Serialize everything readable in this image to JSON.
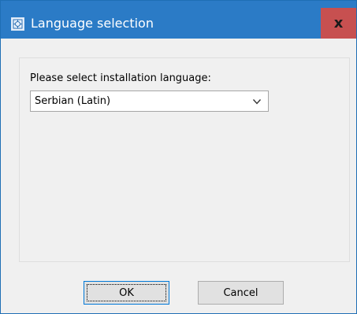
{
  "window": {
    "title": "Language selection",
    "close_label": "x"
  },
  "colors": {
    "titlebar": "#2b7bc6",
    "close_button": "#c75050",
    "dialog_background": "#f0f0f0",
    "focus_border": "#0078d7"
  },
  "icons": {
    "app": "installer-icon",
    "close": "close-icon",
    "dropdown": "chevron-down-icon"
  },
  "form": {
    "prompt": "Please select installation language:",
    "language_select": {
      "value": "Serbian (Latin)"
    }
  },
  "buttons": {
    "ok": "OK",
    "cancel": "Cancel"
  }
}
